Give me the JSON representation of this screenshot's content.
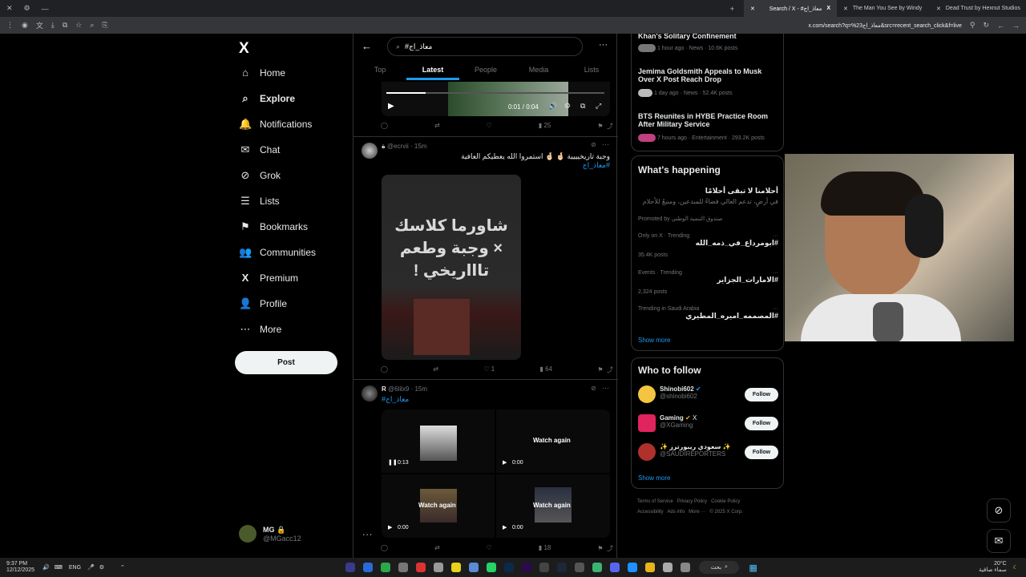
{
  "browser": {
    "tabs": [
      {
        "label": "Search / X - #معاذ_اج"
      },
      {
        "label": "The Man You See by Windy"
      },
      {
        "label": "Dead Trust by Hexnut Studios"
      }
    ],
    "url": "x.com/search?q=%23معاذ_اج&src=recent_search_click&f=live"
  },
  "nav": {
    "logo": "X",
    "items": [
      {
        "icon": "⌂",
        "label": "Home"
      },
      {
        "icon": "⌕",
        "label": "Explore"
      },
      {
        "icon": "🔔",
        "label": "Notifications"
      },
      {
        "icon": "✉",
        "label": "Chat"
      },
      {
        "icon": "⊘",
        "label": "Grok"
      },
      {
        "icon": "☰",
        "label": "Lists"
      },
      {
        "icon": "⚑",
        "label": "Bookmarks"
      },
      {
        "icon": "👥",
        "label": "Communities"
      },
      {
        "icon": "X",
        "label": "Premium"
      },
      {
        "icon": "👤",
        "label": "Profile"
      },
      {
        "icon": "⋯",
        "label": "More"
      }
    ],
    "post_label": "Post",
    "account": {
      "name": "MG 🔒",
      "handle": "@MGacc12"
    }
  },
  "main": {
    "search_value": "#معاذ_اج",
    "tabs": [
      "Top",
      "Latest",
      "People",
      "Media",
      "Lists"
    ],
    "video_time": "0:01 / 0:04",
    "tweet0_actions": {
      "views": "25"
    },
    "tweet1": {
      "handle": "@ecrvii · 15m",
      "name": "ة",
      "text": "وجبة تاريخيييية 🤞🏻 🤞🏻 استمروا الله يعطيكم العافية",
      "hashtag": "#معاذ_اج",
      "image_text": "شاورما كلاسك × وجبة وطعم تاااريخي !",
      "likes": "1",
      "views": "64"
    },
    "tweet2": {
      "name": "R",
      "handle": "@6lilx9 · 15m",
      "hashtag": "#معاذ_اج",
      "video_times": [
        "0:13",
        "0:00",
        "0:00",
        "0:00"
      ],
      "watch_again": "Watch again",
      "views": "18"
    }
  },
  "right": {
    "news": [
      {
        "title": "Khan's Solitary Confinement",
        "meta": "1 hour ago · News · 10.6K posts"
      },
      {
        "title": "Jemima Goldsmith Appeals to Musk Over X Post Reach Drop",
        "meta": "1 day ago · News · 52.4K posts"
      },
      {
        "title": "BTS Reunites in HYBE Practice Room After Military Service",
        "meta": "7 hours ago · Entertainment · 293.2K posts"
      }
    ],
    "happening": {
      "title": "What's happening",
      "promo_title": "أحلامنا لا تبقى أحلامًا",
      "promo_desc": "في أرضٍ، تدعم العالي فضاءً للمبدعين، ومنبعٌ للأحلام",
      "promo_by": "Promoted by صندوق التنمية الوطني",
      "trends": [
        {
          "context": "Only on X · Trending",
          "name": "#ابومرداع_في_ذمه_الله",
          "posts": "35.4K posts"
        },
        {
          "context": "Events · Trending",
          "name": "#الامارات_الجزاير",
          "posts": "2,324 posts"
        },
        {
          "context": "Trending in Saudi Arabia",
          "name": "#المصممه_اميره_المطيري",
          "posts": ""
        }
      ],
      "show_more": "Show more"
    },
    "follow": {
      "title": "Who to follow",
      "users": [
        {
          "name": "Shinobi602",
          "handle": "@shinobi602",
          "color": "#f5c542"
        },
        {
          "name": "Gaming",
          "handle": "@XGaming",
          "color": "#e0245e"
        },
        {
          "name": "✨ سعودي ريبورترز ✨",
          "handle": "@SAUDIREPORTERS",
          "color": "#b0302c"
        }
      ],
      "follow_label": "Follow",
      "show_more": "Show more"
    },
    "footer": [
      "Terms of Service",
      "Privacy Policy",
      "Cookie Policy",
      "Accessibility",
      "Ads info",
      "More ···",
      "© 2025 X Corp."
    ]
  },
  "taskbar": {
    "time": "9:37 PM",
    "date": "12/12/2025",
    "lang": "ENG",
    "search": "بحث",
    "weather": "20°C",
    "weather_desc": "سماء صافية"
  }
}
